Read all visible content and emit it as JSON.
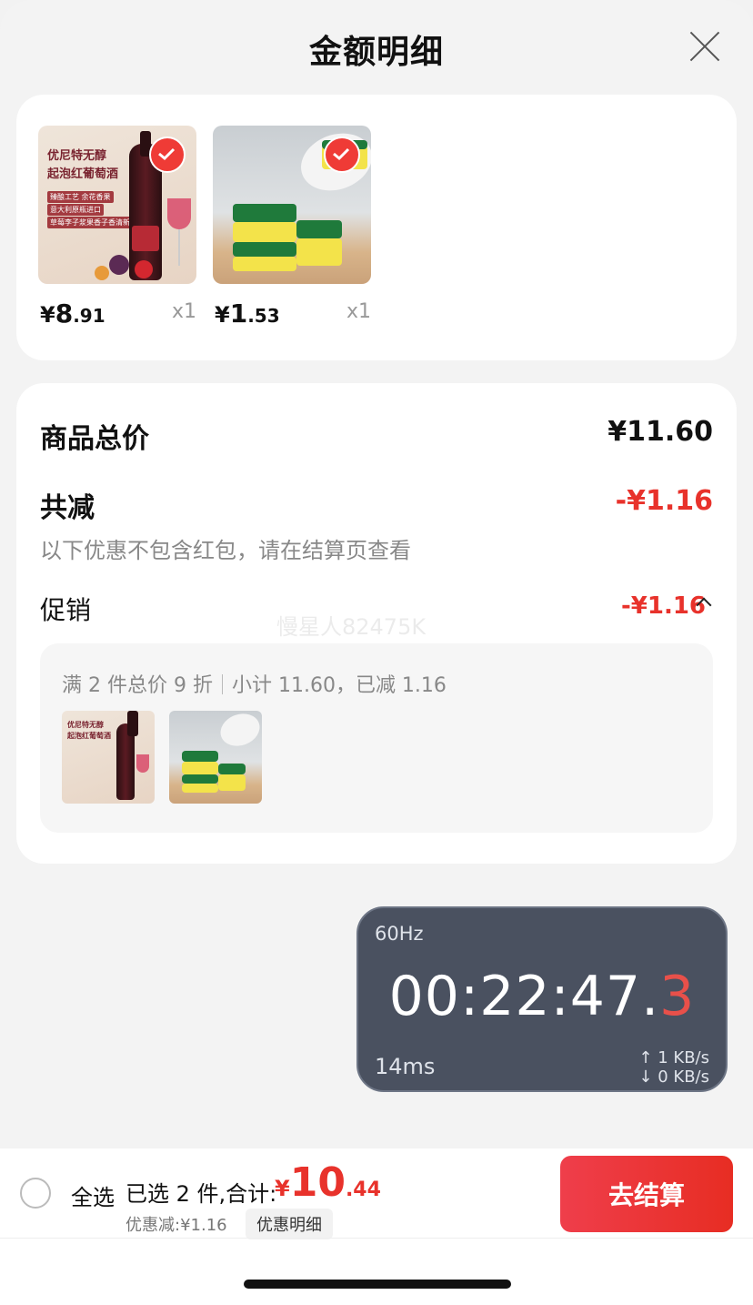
{
  "header": {
    "title": "金额明细"
  },
  "products": [
    {
      "image_text": [
        "优尼特无醇",
        "起泡红葡萄酒"
      ],
      "image_tags": [
        "臻酿工艺 余花香果",
        "意大利原瓶进口",
        "草莓李子浆果香子香清新香气"
      ],
      "price_symbol": "¥",
      "price_int": "8",
      "price_dec": ".91",
      "qty": "x1",
      "selected": true
    },
    {
      "price_symbol": "¥",
      "price_int": "1",
      "price_dec": ".53",
      "qty": "x1",
      "selected": true
    }
  ],
  "summary": {
    "total_label": "商品总价",
    "total_value": "¥11.60",
    "reduce_label": "共减",
    "reduce_value": "-¥1.16",
    "note": "以下优惠不包含红包，请在结算页查看",
    "promo_label": "促销",
    "promo_value": "-¥1.16",
    "watermark": "慢星人82475K",
    "promo_detail": {
      "rule": "满 2 件总价 9 折",
      "subtotal": "小计 11.60，已减 1.16"
    }
  },
  "timer": {
    "hz": "60Hz",
    "time_main": "00:22:47.",
    "time_last": "3",
    "ms": "14ms",
    "up": "↑ 1 KB/s",
    "down": "↓ 0 KB/s"
  },
  "bottom_bar": {
    "select_all": "全选",
    "selected_text": "已选 2 件,合计:",
    "total_symbol": "¥",
    "total_int": "10",
    "total_dec": ".44",
    "discount_text": "优惠减:¥1.16",
    "discount_detail": "优惠明细",
    "checkout": "去结算"
  },
  "colors": {
    "accent": "#e8322b",
    "timer_bg": "#4a5160"
  }
}
